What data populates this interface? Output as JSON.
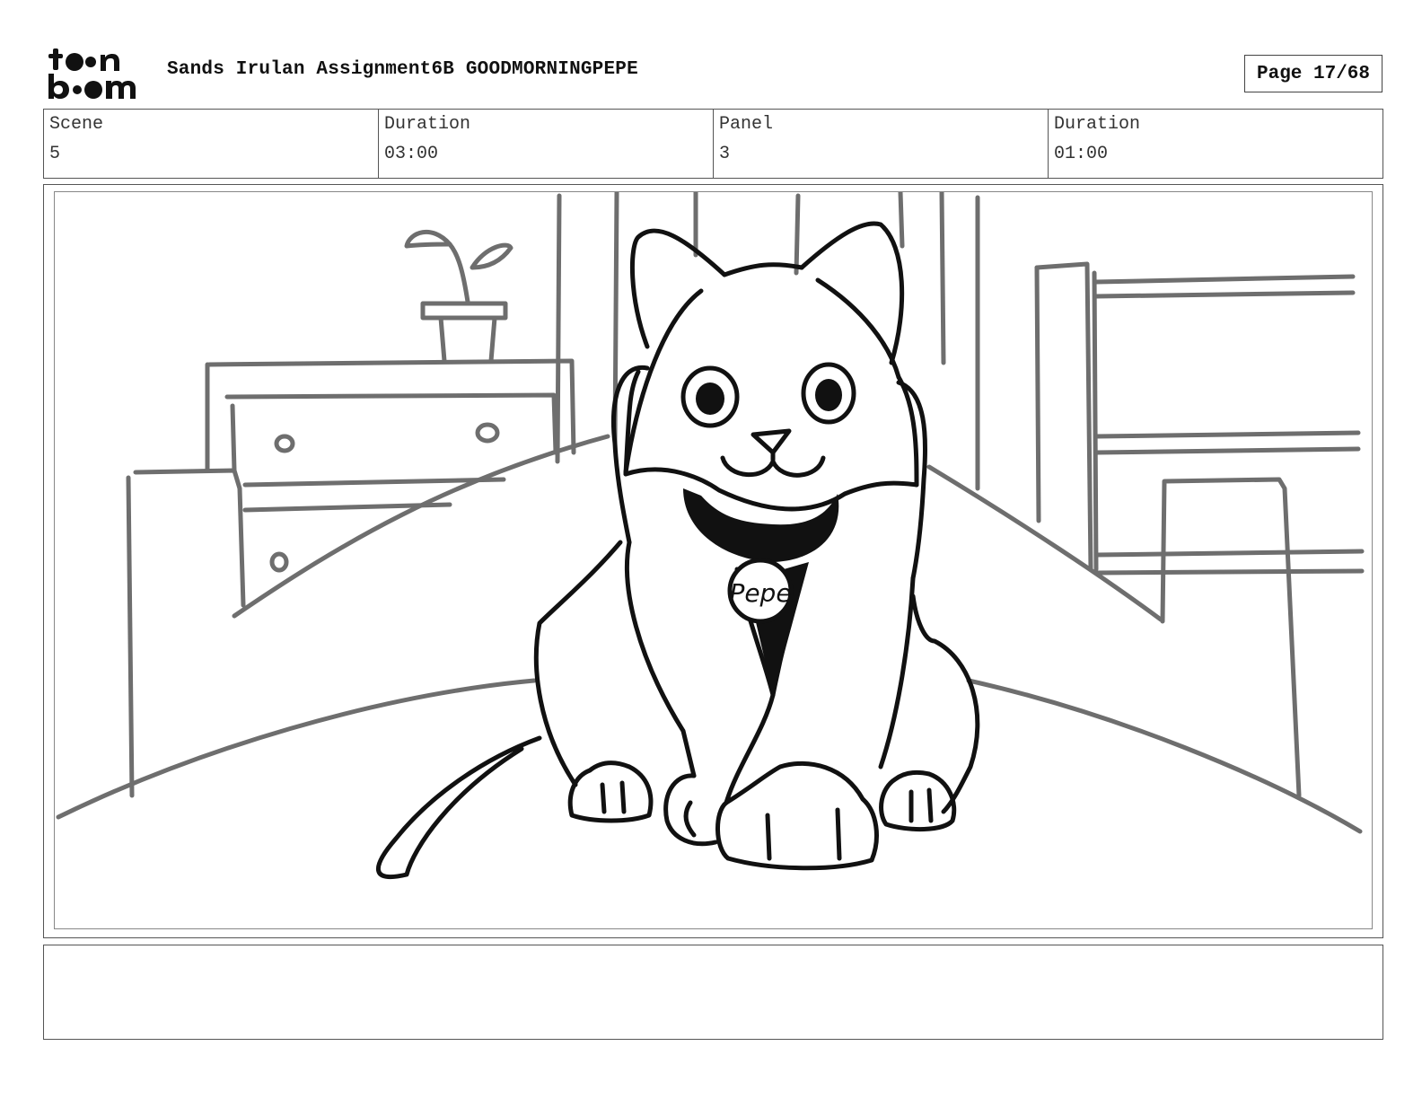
{
  "header": {
    "logo_text": "toonboom",
    "document_title": "Sands Irulan Assignment6B GOODMORNINGPEPE",
    "page_indicator": "Page 17/68"
  },
  "info": {
    "scene_label": "Scene",
    "scene_value": "5",
    "scene_duration_label": "Duration",
    "scene_duration_value": "03:00",
    "panel_label": "Panel",
    "panel_value": "3",
    "panel_duration_label": "Duration",
    "panel_duration_value": "01:00"
  },
  "panel": {
    "collar_tag_text": "Pepe"
  },
  "notes": {
    "text": ""
  }
}
